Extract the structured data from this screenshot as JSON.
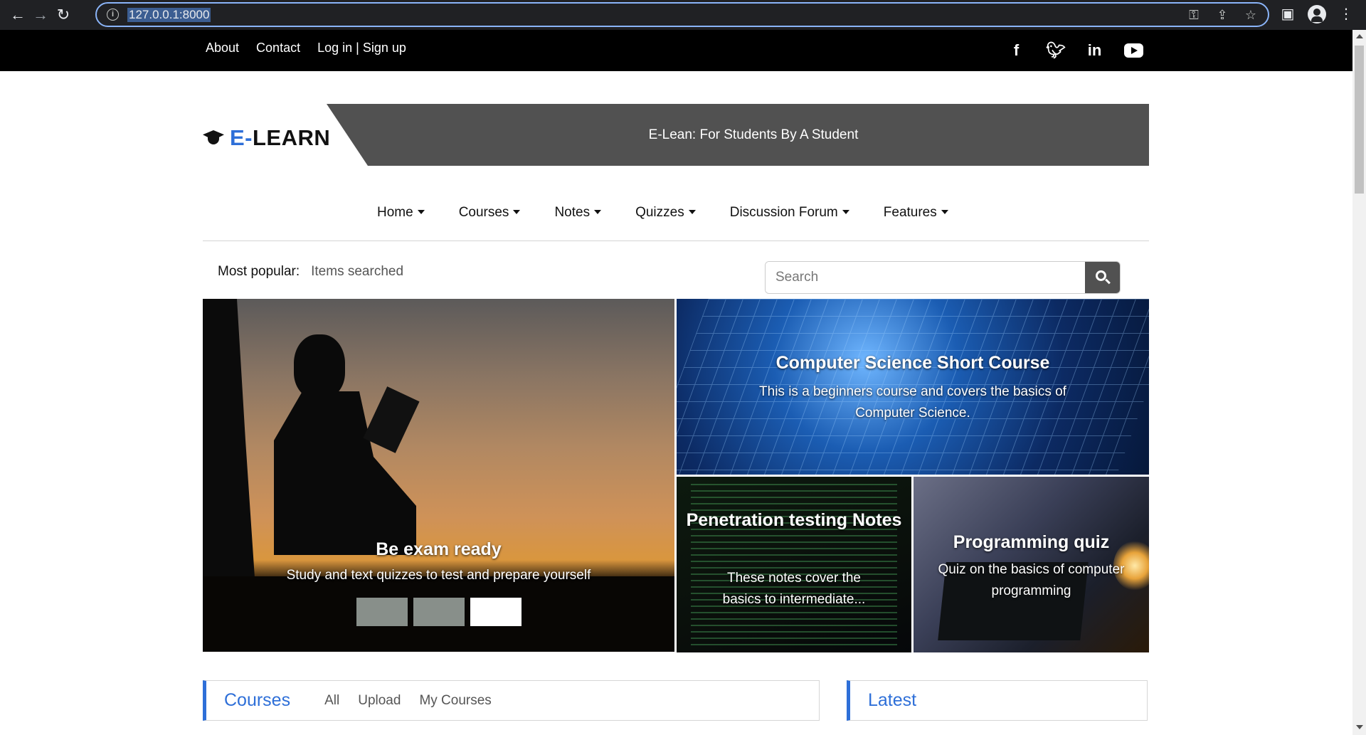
{
  "browser": {
    "url": "127.0.0.1:8000"
  },
  "topbar": {
    "links": [
      "About",
      "Contact",
      "Log in | Sign up"
    ],
    "social": [
      "facebook-icon",
      "twitter-icon",
      "linkedin-icon",
      "youtube-icon"
    ]
  },
  "header": {
    "logo_prefix": "E-",
    "logo_suffix": "LEARN",
    "tagline": "E-Lean: For Students By A Student"
  },
  "nav": {
    "items": [
      "Home",
      "Courses",
      "Notes",
      "Quizzes",
      "Discussion Forum",
      "Features"
    ]
  },
  "popular": {
    "label": "Most popular:",
    "value": "Items searched"
  },
  "search": {
    "placeholder": "Search"
  },
  "hero": {
    "main": {
      "title": "Be exam ready",
      "description": "Study and text quizzes to test and prepare yourself"
    },
    "cs_course": {
      "title": "Computer Science Short Course",
      "description": "This is a beginners course and covers the basics of Computer Science."
    },
    "pen_notes": {
      "title": "Penetration testing Notes",
      "description": "These notes cover the basics to intermediate..."
    },
    "prog_quiz": {
      "title": "Programming quiz",
      "description": "Quiz on the basics of computer programming"
    }
  },
  "courses_panel": {
    "title": "Courses",
    "tabs": [
      "All",
      "Upload",
      "My Courses"
    ]
  },
  "latest_panel": {
    "title": "Latest"
  },
  "colors": {
    "accent": "#2e6fd8",
    "banner": "#515151",
    "topbar": "#000000"
  }
}
